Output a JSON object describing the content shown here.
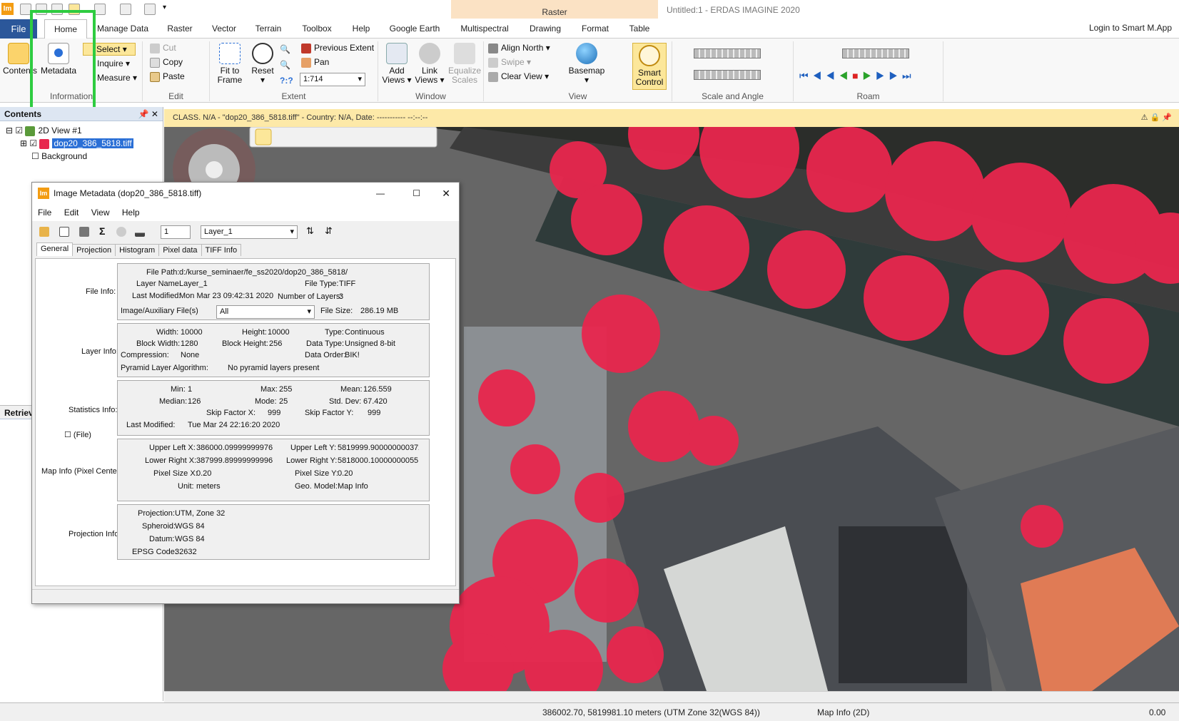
{
  "app": {
    "title": "Untitled:1 - ERDAS IMAGINE 2020",
    "icon_text": "Im",
    "context_tab": "Raster",
    "login": "Login to Smart M.App"
  },
  "tabs": [
    "File",
    "Home",
    "Manage Data",
    "Raster",
    "Vector",
    "Terrain",
    "Toolbox",
    "Help",
    "Google Earth",
    "Multispectral",
    "Drawing",
    "Format",
    "Table"
  ],
  "ribbon": {
    "information": {
      "label": "Information",
      "contents": "Contents",
      "metadata": "Metadata"
    },
    "select": {
      "select": "Select",
      "inquire": "Inquire",
      "measure": "Measure"
    },
    "edit": {
      "label": "Edit",
      "cut": "Cut",
      "copy": "Copy",
      "paste": "Paste"
    },
    "extent": {
      "label": "Extent",
      "fit1": "Fit to",
      "fit2": "Frame",
      "reset": "Reset",
      "prev": "Previous Extent",
      "pan": "Pan",
      "scale": "1:714",
      "qq": "?:?"
    },
    "window": {
      "label": "Window",
      "add1": "Add",
      "add2": "Views",
      "link1": "Link",
      "link2": "Views",
      "eq1": "Equalize",
      "eq2": "Scales"
    },
    "view": {
      "label": "View",
      "align": "Align North",
      "swipe": "Swipe",
      "clear": "Clear View",
      "basemap": "Basemap",
      "smart1": "Smart",
      "smart2": "Control"
    },
    "scale_angle": {
      "label": "Scale and Angle"
    },
    "roam": {
      "label": "Roam"
    }
  },
  "contents_panel": {
    "title": "Contents",
    "view": "2D View #1",
    "layer": "dop20_386_5818.tiff",
    "background": "Background",
    "retrieve": "Retriev"
  },
  "map_info_bar": "CLASS. N/A - \"dop20_386_5818.tiff\" - Country: N/A, Date: ----------- --:--:--",
  "status": {
    "coords": "386002.70, 5819981.10 meters (UTM Zone 32(WGS 84))",
    "mode": "Map Info (2D)",
    "value": "0.00"
  },
  "dialog": {
    "title": "Image Metadata (dop20_386_5818.tiff)",
    "menu": [
      "File",
      "Edit",
      "View",
      "Help"
    ],
    "layer_num": "1",
    "layer_select": "Layer_1",
    "tabs": [
      "General",
      "Projection",
      "Histogram",
      "Pixel data",
      "TIFF Info"
    ],
    "file_info": {
      "section": "File Info:",
      "path_lbl": "File Path:",
      "path": "d:/kurse_seminaer/fe_ss2020/dop20_386_5818/",
      "lname_lbl": "Layer Name:",
      "lname": "Layer_1",
      "ftype_lbl": "File Type:",
      "ftype": "TIFF",
      "lmod_lbl": "Last Modified:",
      "lmod": "Mon Mar 23 09:42:31 2020",
      "nlayers_lbl": "Number of Layers:",
      "nlayers": "3",
      "aux_lbl": "Image/Auxiliary File(s)",
      "aux": "All",
      "fsize_lbl": "File Size:",
      "fsize": "286.19 MB"
    },
    "layer_info": {
      "section": "Layer Info:",
      "width_lbl": "Width:",
      "width": "10000",
      "height_lbl": "Height:",
      "height": "10000",
      "type_lbl": "Type:",
      "type": "Continuous",
      "bw_lbl": "Block Width:",
      "bw": "1280",
      "bh_lbl": "Block Height:",
      "bh": "256",
      "dtype_lbl": "Data Type:",
      "dtype": "Unsigned 8-bit",
      "comp_lbl": "Compression:",
      "comp": "None",
      "dorder_lbl": "Data Order:",
      "dorder": "BIK!",
      "pyr_lbl": "Pyramid Layer Algorithm:",
      "pyr": "No pyramid layers present"
    },
    "stats_info": {
      "section": "Statistics Info:",
      "min_lbl": "Min:",
      "min": "1",
      "max_lbl": "Max:",
      "max": "255",
      "mean_lbl": "Mean:",
      "mean": "126.559",
      "median_lbl": "Median:",
      "median": "126",
      "mode_lbl": "Mode:",
      "mode": "25",
      "std_lbl": "Std. Dev:",
      "std": "67.420",
      "skx_lbl": "Skip Factor X:",
      "skx": "999",
      "sky_lbl": "Skip Factor Y:",
      "sky": "999",
      "lmod_lbl": "Last Modified:",
      "lmod": "Tue Mar 24 22:16:20 2020",
      "file_chk": "(File)"
    },
    "map_info": {
      "section": "Map Info (Pixel Center):",
      "ulx_lbl": "Upper Left X:",
      "ulx": "386000.09999999976",
      "uly_lbl": "Upper Left Y:",
      "uly": "5819999.900000000372",
      "lrx_lbl": "Lower Right X:",
      "lrx": "387999.89999999996",
      "lry_lbl": "Lower Right Y:",
      "lry": "5818000.10000000055",
      "psx_lbl": "Pixel Size X:",
      "psx": "0.20",
      "psy_lbl": "Pixel Size Y:",
      "psy": "0.20",
      "unit_lbl": "Unit:",
      "unit": "meters",
      "geo_lbl": "Geo. Model:",
      "geo": "Map Info"
    },
    "proj_info": {
      "section": "Projection Info:",
      "proj_lbl": "Projection:",
      "proj": "UTM, Zone 32",
      "sph_lbl": "Spheroid:",
      "sph": "WGS 84",
      "datum_lbl": "Datum:",
      "datum": "WGS 84",
      "epsg_lbl": "EPSG Code:",
      "epsg": "32632"
    }
  },
  "colors": {
    "file_tab": "#2b579a",
    "highlight_box": "#2ecc40",
    "vegetation": "#e8264d",
    "info_bar": "#fde9a8"
  }
}
